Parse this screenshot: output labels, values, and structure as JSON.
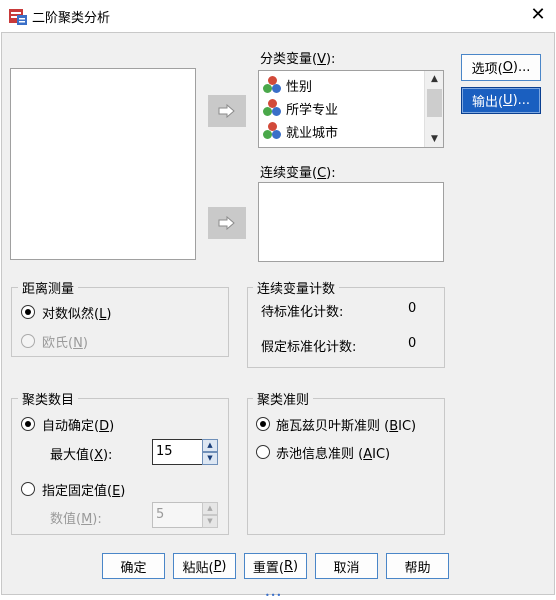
{
  "window": {
    "title": "二阶聚类分析",
    "close_glyph": "✕"
  },
  "labels": {
    "categorical_prefix": "分类变量(",
    "categorical_key": "V",
    "categorical_suffix": "):",
    "continuous_prefix": "连续变量(",
    "continuous_key": "C",
    "continuous_suffix": "):"
  },
  "categorical_vars": [
    {
      "label": "性别"
    },
    {
      "label": "所学专业"
    },
    {
      "label": "就业城市"
    }
  ],
  "side_buttons": {
    "options_prefix": "选项(",
    "options_key": "O",
    "options_suffix": ")...",
    "output_prefix": "输出(",
    "output_key": "U",
    "output_suffix": ")..."
  },
  "distance": {
    "title": "距离测量",
    "loglik_prefix": "对数似然(",
    "loglik_key": "L",
    "loglik_suffix": ")",
    "euclid_prefix": "欧氏(",
    "euclid_key": "N",
    "euclid_suffix": ")"
  },
  "continuous_count": {
    "title": "连续变量计数",
    "to_standardize_label": "待标准化计数:",
    "to_standardize_value": "0",
    "assumed_label": "假定标准化计数:",
    "assumed_value": "0"
  },
  "cluster_count": {
    "title": "聚类数目",
    "auto_prefix": "自动确定(",
    "auto_key": "D",
    "auto_suffix": ")",
    "max_prefix": "最大值(",
    "max_key": "X",
    "max_suffix": "):",
    "max_value": "15",
    "fixed_prefix": "指定固定值(",
    "fixed_key": "E",
    "fixed_suffix": ")",
    "number_prefix": "数值(",
    "number_key": "M",
    "number_suffix": "):",
    "number_value": "5"
  },
  "criterion": {
    "title": "聚类准则",
    "bic_prefix": "施瓦兹贝叶斯准则 (",
    "bic_key": "B",
    "bic_suffix": "IC)",
    "aic_prefix": "赤池信息准则 (",
    "aic_key": "A",
    "aic_suffix": "IC)"
  },
  "bottom_buttons": {
    "ok": "确定",
    "paste_prefix": "粘贴(",
    "paste_key": "P",
    "paste_suffix": ")",
    "reset_prefix": "重置(",
    "reset_key": "R",
    "reset_suffix": ")",
    "cancel": "取消",
    "help": "帮助"
  },
  "icons": {
    "move_arrow": "move-right-arrow-icon",
    "nominal_var": "nominal-variable-icon",
    "spin_up_glyph": "▲",
    "spin_down_glyph": "▼",
    "scroll_up_glyph": "▲",
    "scroll_down_glyph": "▼",
    "grip_glyph": "•••"
  },
  "colors": {
    "output_button_bg": "#1a5fc0",
    "button_border": "#4a86c8",
    "dialog_bg": "#f0f0f0"
  }
}
